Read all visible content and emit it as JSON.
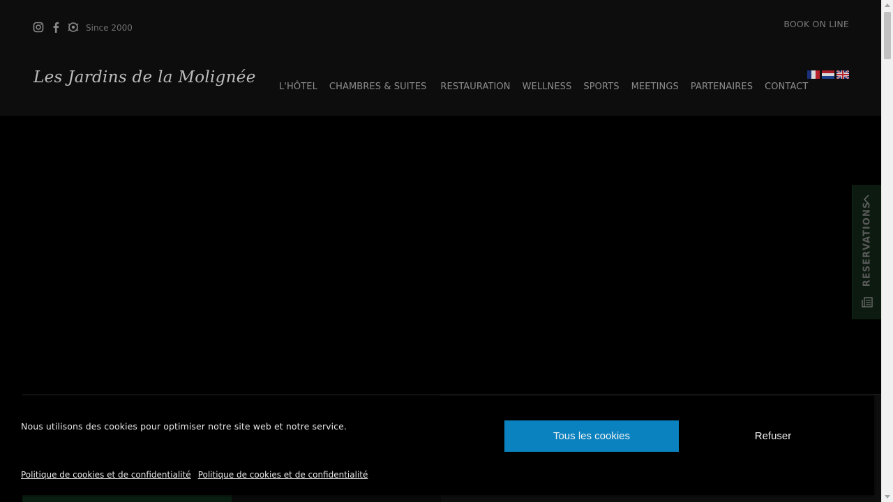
{
  "header": {
    "since": "Since 2000",
    "book_online": "BOOK ON LINE",
    "logo": "Les Jardins de la Molignée",
    "social_icons": [
      "instagram-icon",
      "facebook-icon",
      "tripadvisor-icon"
    ]
  },
  "nav": {
    "items": [
      {
        "label": "L'HÔTEL"
      },
      {
        "label": "CHAMBRES & SUITES"
      },
      {
        "label": "RESTAURATION"
      },
      {
        "label": "WELLNESS"
      },
      {
        "label": "SPORTS"
      },
      {
        "label": "MEETINGS"
      },
      {
        "label": "PARTENAIRES"
      },
      {
        "label": "CONTACT"
      }
    ]
  },
  "languages": [
    "fr-flag-icon",
    "nl-flag-icon",
    "en-flag-icon"
  ],
  "reservations": {
    "label": "RESERVATIONS"
  },
  "cookie": {
    "message": "Nous utilisons des cookies pour optimiser notre site web et notre service.",
    "accept_all": "Tous les cookies",
    "refuse": "Refuser",
    "links": [
      "Politique de cookies et de confidentialité",
      "Politique de cookies et de confidentialité"
    ]
  },
  "colors": {
    "accept_button": "#0b82c0",
    "header_bg": "#0d0d0d",
    "reservation_bg": "#0c1a10"
  }
}
